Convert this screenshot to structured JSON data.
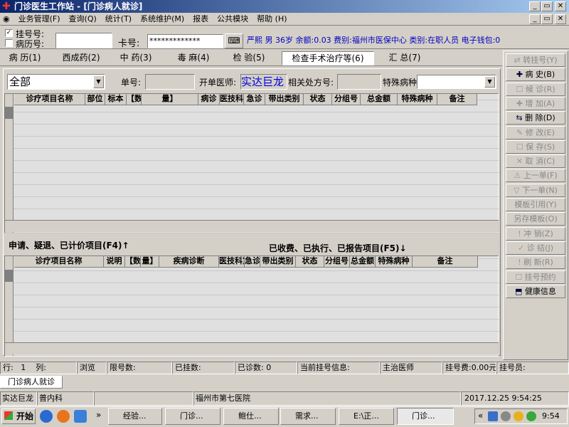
{
  "window": {
    "title": "门诊医生工作站 - [门诊病人就诊]"
  },
  "menu": [
    "业务管理(F)",
    "查询(Q)",
    "统计(T)",
    "系统维护(M)",
    "报表",
    "公共模块",
    "帮助 (H)"
  ],
  "patient_bar": {
    "reg_label": "挂号号:",
    "record_label": "病历号:",
    "card_label": "卡号:",
    "card_value": "*************",
    "info": "严熙 男 36岁 余额:0.03 费别:福州市医保中心 类别:在职人员 电子钱包:0"
  },
  "tabs": [
    "病 历(1)",
    "西成药(2)",
    "中 药(3)",
    "毒 麻(4)",
    "检 验(5)",
    "检查手术治疗等(6)",
    "汇 总(7)"
  ],
  "filter": {
    "category": "全部",
    "order_label": "单号:",
    "doctor_label": "开单医师:",
    "doctor_value": "实达巨龙",
    "related_label": "相关处方号:",
    "disease_label": "特殊病种"
  },
  "grid_top_headers": [
    "诊疗项目名称",
    "部位",
    "标本",
    "【数",
    "量】",
    "病诊",
    "医技科室",
    "急诊",
    "带出类别",
    "状态",
    "分组号",
    "总金额",
    "特殊病种",
    "备注"
  ],
  "mid_labels": {
    "left": "申请、疑退、已计价项目(F4)↑",
    "right": "已收费、已执行、已报告项目(F5)↓"
  },
  "grid_bottom_headers": [
    "诊疗项目名称",
    "说明",
    "【数",
    "量】",
    "疾病诊断",
    "医技科室",
    "急诊",
    "带出类别",
    "状态",
    "分组号",
    "总金额",
    "特殊病种",
    "备注"
  ],
  "sidebar": [
    "转挂号(Y)",
    "病 史(B)",
    "候 诊(R)",
    "增 加(A)",
    "删 除(D)",
    "修 改(E)",
    "保 存(S)",
    "取 消(C)",
    "上一单(F)",
    "下一单(N)",
    "模板引用(Y)",
    "另存模板(O)",
    "冲 销(Z)",
    "诊 结(J)",
    "刷 新(R)",
    "挂号预约",
    "健康信息"
  ],
  "status_row": {
    "row_label": "行:",
    "row_value": "1",
    "col_label": "列:",
    "browse": "浏览",
    "limit_label": "限号数:",
    "registered_label": "已挂数:",
    "seen_label": "已诊数:",
    "seen_value": "0",
    "current_label": "当前挂号信息:",
    "doctor_label": "主治医师",
    "fee_label": "挂号费:",
    "fee_value": "0.00元",
    "staff_label": "挂号员:"
  },
  "doc_tab": "门诊病人就诊",
  "footer": {
    "user": "实达巨龙",
    "dept": "普内科",
    "hospital": "福州市第七医院",
    "datetime": "2017.12.25 9:54:25"
  },
  "taskbar": {
    "start": "开始",
    "items": [
      "经验...",
      "门诊...",
      "鲍仕...",
      "需求...",
      "E:\\正...",
      "门诊..."
    ],
    "time": "9:54"
  }
}
